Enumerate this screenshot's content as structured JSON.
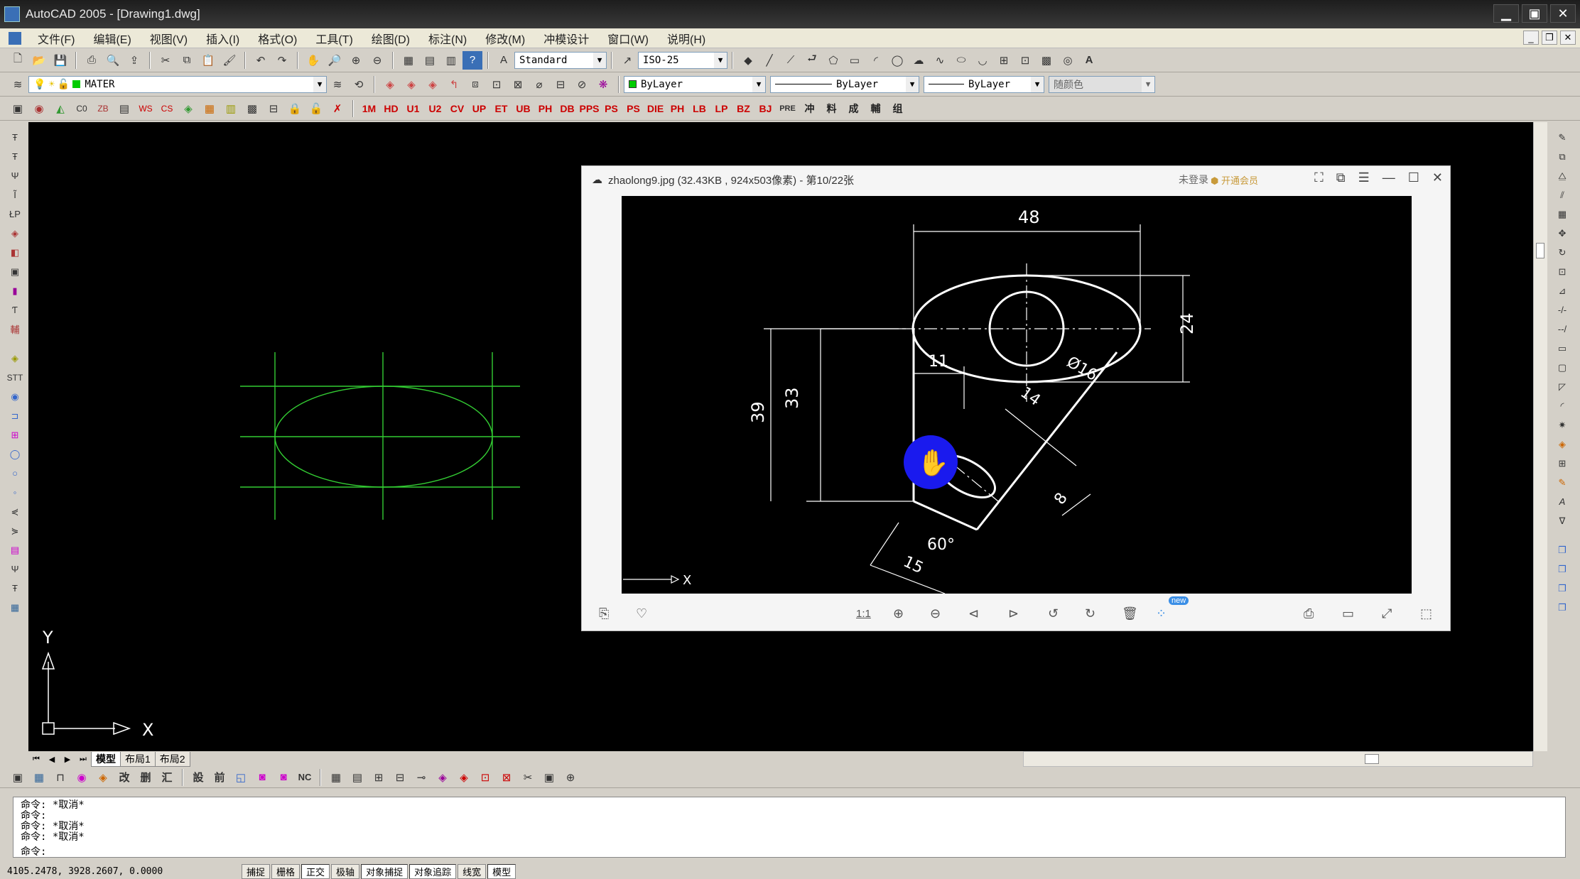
{
  "window": {
    "title": "AutoCAD 2005 - [Drawing1.dwg]",
    "controls": [
      "_",
      "□",
      "✕"
    ]
  },
  "menu": [
    "文件(F)",
    "编辑(E)",
    "视图(V)",
    "插入(I)",
    "格式(O)",
    "工具(T)",
    "绘图(D)",
    "标注(N)",
    "修改(M)",
    "冲模设计",
    "窗口(W)",
    "说明(H)"
  ],
  "toolbar_standard": {
    "text_style": "Standard",
    "dim_style": "ISO-25"
  },
  "toolbar_layers": {
    "layer_name": "MATER",
    "color": "ByLayer",
    "linetype": "ByLayer",
    "lineweight": "ByLayer",
    "plotstyle": "随颜色"
  },
  "red_buttons": [
    "1M",
    "HD",
    "U1",
    "U2",
    "CV",
    "UP",
    "ET",
    "UB",
    "PH",
    "DB",
    "PPS",
    "PS",
    "PS",
    "DIE",
    "PH",
    "LB",
    "LP",
    "BZ",
    "BJ",
    "PRE",
    "冲",
    "料",
    "成",
    "輔",
    "组"
  ],
  "viewer": {
    "title": "zhaolong9.jpg (32.43KB , 924x503像素) - 第10/22张",
    "login": "未登录",
    "vip": "开通会员",
    "badge": "new",
    "ratio_label": "1:1",
    "drawing_dims": {
      "d48": "48",
      "d24": "24",
      "d16": "Ø16",
      "d11": "11",
      "d33": "33",
      "d39": "39",
      "d14": "14",
      "d8": "8",
      "d60": "60°",
      "d15": "15",
      "x_axis": "X"
    }
  },
  "ucs": {
    "y_label": "Y",
    "x_label": "X"
  },
  "tabs": [
    "模型",
    "布局1",
    "布局2"
  ],
  "bottom_toolbar_text": [
    "改",
    "删",
    "汇",
    "設",
    "前",
    "NC"
  ],
  "command_lines": [
    "命令: *取消*",
    "命令:",
    "命令: *取消*",
    "命令: *取消*"
  ],
  "command_prompt": "命令:",
  "status": {
    "coords": "4105.2478, 3928.2607, 0.0000",
    "buttons": [
      "捕捉",
      "栅格",
      "正交",
      "极轴",
      "对象捕捉",
      "对象追踪",
      "线宽",
      "模型"
    ]
  },
  "colors": {
    "canvas_bg": "#000000",
    "ellipse_green": "#33cc33",
    "cursor_blue": "#1a1aee"
  }
}
